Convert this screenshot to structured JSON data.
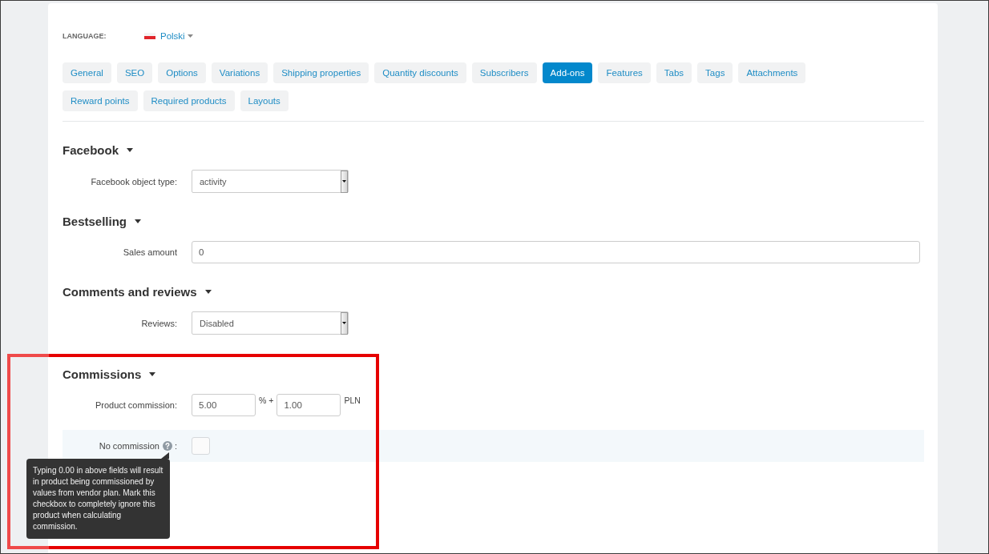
{
  "language": {
    "label": "LANGUAGE:",
    "value": "Polski"
  },
  "tabs": [
    {
      "label": "General",
      "selected": false
    },
    {
      "label": "SEO",
      "selected": false
    },
    {
      "label": "Options",
      "selected": false
    },
    {
      "label": "Variations",
      "selected": false
    },
    {
      "label": "Shipping properties",
      "selected": false
    },
    {
      "label": "Quantity discounts",
      "selected": false
    },
    {
      "label": "Subscribers",
      "selected": false
    },
    {
      "label": "Add-ons",
      "selected": true
    },
    {
      "label": "Features",
      "selected": false
    },
    {
      "label": "Tabs",
      "selected": false
    },
    {
      "label": "Tags",
      "selected": false
    },
    {
      "label": "Attachments",
      "selected": false
    },
    {
      "label": "Reward points",
      "selected": false
    },
    {
      "label": "Required products",
      "selected": false
    },
    {
      "label": "Layouts",
      "selected": false
    }
  ],
  "sections": [
    {
      "title": "Facebook",
      "expanded": true,
      "fields": [
        {
          "kind": "select",
          "label": "Facebook object type:",
          "value": "activity"
        }
      ]
    },
    {
      "title": "Bestselling",
      "expanded": true,
      "fields": [
        {
          "kind": "text",
          "label": "Sales amount",
          "value": "0"
        }
      ]
    },
    {
      "title": "Comments and reviews",
      "expanded": true,
      "fields": [
        {
          "kind": "select",
          "label": "Reviews:",
          "value": "Disabled"
        }
      ]
    },
    {
      "title": "Commissions",
      "expanded": true,
      "fields": [
        {
          "kind": "commission",
          "label": "Product commission:",
          "percent_value": "5.00",
          "percent_sign": "% +",
          "fixed_value": "1.00",
          "currency": "PLN"
        },
        {
          "kind": "checkbox",
          "label": "No commission",
          "label_suffix": ":",
          "checked": false,
          "highlighted": true,
          "tooltip": "Typing 0.00 in above fields will result in product being commissioned by values from vendor plan. Mark this checkbox to completely ignore this product when calculating commission."
        }
      ]
    }
  ]
}
